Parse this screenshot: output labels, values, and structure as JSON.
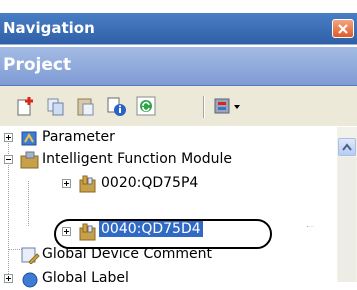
{
  "window": {
    "title": "Navigation",
    "close_icon": "close-icon"
  },
  "project_bar": {
    "label": "Project"
  },
  "toolbar": {
    "buttons": [
      "new-data-icon",
      "copy-icon",
      "paste-icon",
      "properties-icon",
      "refresh-icon",
      "project-settings-icon"
    ]
  },
  "tree": {
    "items": [
      {
        "label": "Parameter",
        "expander": "plus",
        "icon": "parameter-icon"
      },
      {
        "label": "Intelligent Function Module",
        "expander": "minus",
        "icon": "module-folder-icon"
      },
      {
        "label": "0020:QD75P4",
        "expander": "plus",
        "icon": "module-icon"
      },
      {
        "label": "0040:QD75D4",
        "expander": "plus",
        "icon": "module-icon",
        "selected": true
      },
      {
        "label": "Global Device Comment",
        "icon": "device-comment-icon"
      },
      {
        "label": "Global Label",
        "expander": "plus",
        "icon": "global-label-icon"
      }
    ]
  },
  "colors": {
    "title_bar": "#2f5fa8",
    "project_bar": "#8aa4d9",
    "selection": "#316ac5",
    "close_button": "#df5a2a"
  }
}
